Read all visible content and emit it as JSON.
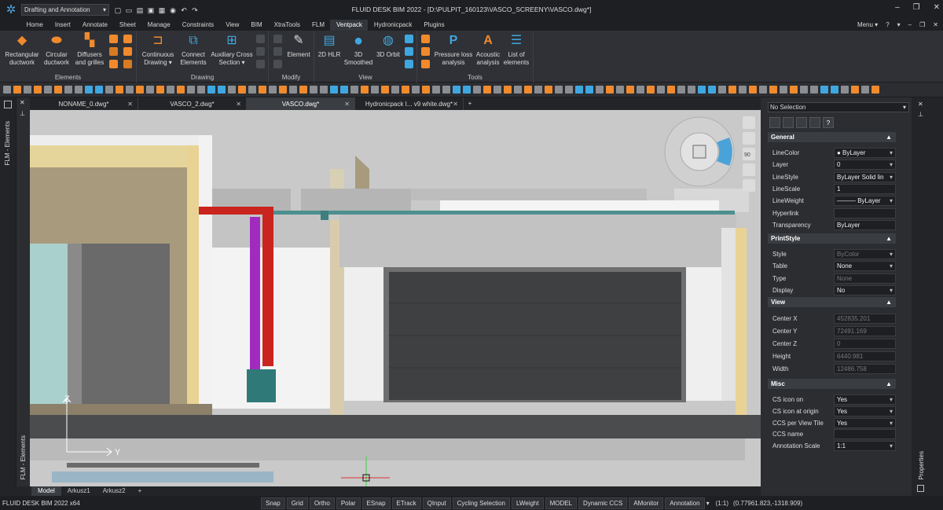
{
  "app": {
    "title": "FLUID DESK BIM 2022 - [D:\\PULPIT_160123\\VASCO_SCREENY\\VASCO.dwg*]",
    "workspace": "Drafting and Annotation",
    "menu_label": "Menu",
    "window_controls": [
      "‒",
      "❐",
      "✕"
    ]
  },
  "menus": [
    "Home",
    "Insert",
    "Annotate",
    "Sheet",
    "Manage",
    "Constraints",
    "View",
    "BIM",
    "XtraTools",
    "FLM",
    "Ventpack",
    "Hydronicpack",
    "Plugins"
  ],
  "ribbon": {
    "elements": {
      "title": "Elements",
      "buttons": [
        "Rectangular ductwork",
        "Circular ductwork",
        "Diffusers and grilles"
      ]
    },
    "drawing": {
      "title": "Drawing",
      "buttons": [
        "Continuous Drawing",
        "Connect Elements",
        "Auxiliary Cross Section"
      ]
    },
    "modify": {
      "title": "Modify",
      "buttons": [
        "Element"
      ]
    },
    "view": {
      "title": "View",
      "buttons": [
        "2D HLR",
        "3D Smoothed",
        "3D Orbit"
      ]
    },
    "tools": {
      "title": "Tools",
      "buttons": [
        "Pressure loss analysis",
        "Acoustic analysis",
        "List of elements"
      ]
    }
  },
  "doc_tabs": [
    "NONAME_0.dwg*",
    "VASCO_2.dwg*",
    "VASCO.dwg*",
    "Hydronicpack I... v9 white.dwg*"
  ],
  "left_panel_label": "FLM - Elements",
  "left_panel_label2": "FLM - Elements",
  "right_panel_label": "Properties",
  "viewcube": {
    "zoom": "90"
  },
  "ucs": {
    "x": "X",
    "y": "Y",
    "z": "Z"
  },
  "layout_tabs": [
    "Model",
    "Arkusz1",
    "Arkusz2"
  ],
  "statusbar": {
    "app_version": "FLUID DESK BIM 2022 x64",
    "buttons": [
      "Snap",
      "Grid",
      "Ortho",
      "Polar",
      "ESnap",
      "ETrack",
      "QInput",
      "Cycling Selection",
      "LWeight",
      "MODEL",
      "Dynamic CCS",
      "AMonitor",
      "Annotation"
    ],
    "scale": "(1:1)",
    "coords": "(0.77961.823,-1318.909)"
  },
  "properties": {
    "selection": "No Selection",
    "general": {
      "title": "General",
      "rows": [
        [
          "LineColor",
          "● ByLayer"
        ],
        [
          "Layer",
          "0"
        ],
        [
          "LineStyle",
          "ByLayer      Solid lin"
        ],
        [
          "LineScale",
          "1"
        ],
        [
          "LineWeight",
          "——— ByLayer"
        ],
        [
          "Hyperlink",
          ""
        ],
        [
          "Transparency",
          "ByLayer"
        ]
      ]
    },
    "printstyle": {
      "title": "PrintStyle",
      "rows": [
        [
          "Style",
          "ByColor"
        ],
        [
          "Table",
          "None"
        ],
        [
          "Type",
          "None"
        ],
        [
          "Display",
          "No"
        ]
      ]
    },
    "view": {
      "title": "View",
      "rows": [
        [
          "Center X",
          "452835.201"
        ],
        [
          "Center Y",
          "72491.169"
        ],
        [
          "Center Z",
          "0"
        ],
        [
          "Height",
          "6440.981"
        ],
        [
          "Width",
          "12486.758"
        ]
      ]
    },
    "misc": {
      "title": "Misc",
      "rows": [
        [
          "CS icon on",
          "Yes"
        ],
        [
          "CS icon at origin",
          "Yes"
        ],
        [
          "CCS per View Tile",
          "Yes"
        ],
        [
          "CCS name",
          ""
        ],
        [
          "Annotation Scale",
          "1:1"
        ]
      ]
    }
  }
}
